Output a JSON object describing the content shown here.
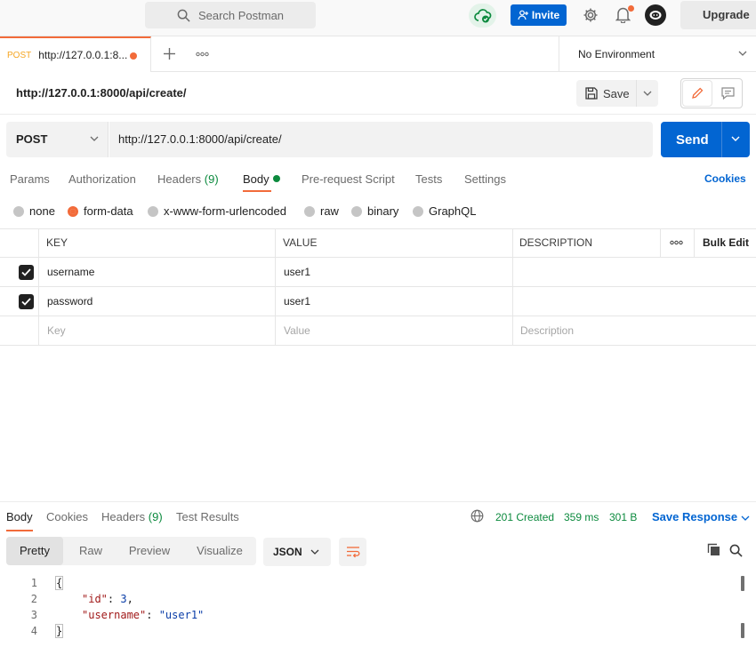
{
  "topbar": {
    "search_placeholder": "Search Postman",
    "invite_label": "Invite",
    "upgrade_label": "Upgrade"
  },
  "tabs": {
    "active": {
      "method": "POST",
      "url": "http://127.0.0.1:8..."
    },
    "environment": "No Environment"
  },
  "request": {
    "title": "http://127.0.0.1:8000/api/create/",
    "save_label": "Save",
    "method": "POST",
    "url": "http://127.0.0.1:8000/api/create/",
    "send_label": "Send",
    "subtabs": {
      "params": "Params",
      "authorization": "Authorization",
      "headers": "Headers",
      "headers_count": "(9)",
      "body": "Body",
      "pre_request": "Pre-request Script",
      "tests": "Tests",
      "settings": "Settings"
    },
    "cookies_label": "Cookies",
    "body_types": {
      "none": "none",
      "form_data": "form-data",
      "urlencoded": "x-www-form-urlencoded",
      "raw": "raw",
      "binary": "binary",
      "graphql": "GraphQL"
    },
    "table": {
      "headers": {
        "key": "KEY",
        "value": "VALUE",
        "description": "DESCRIPTION",
        "bulk_edit": "Bulk Edit"
      },
      "rows": [
        {
          "key": "username",
          "value": "user1"
        },
        {
          "key": "password",
          "value": "user1"
        }
      ],
      "placeholders": {
        "key": "Key",
        "value": "Value",
        "description": "Description"
      }
    }
  },
  "response": {
    "tabs": {
      "body": "Body",
      "cookies": "Cookies",
      "headers": "Headers",
      "headers_count": "(9)",
      "test_results": "Test Results"
    },
    "status": "201 Created",
    "time": "359 ms",
    "size": "301 B",
    "save_response_label": "Save Response",
    "views": {
      "pretty": "Pretty",
      "raw": "Raw",
      "preview": "Preview",
      "visualize": "Visualize"
    },
    "format": "JSON",
    "code": {
      "line_numbers": [
        "1",
        "2",
        "3",
        "4"
      ],
      "open_brace": "{",
      "close_brace": "}",
      "id_key": "\"id\"",
      "id_value": "3",
      "username_key": "\"username\"",
      "username_value": "\"user1\""
    }
  },
  "colors": {
    "accent": "#f26b3a",
    "primary": "#0265d2",
    "success": "#0c8a3e"
  }
}
